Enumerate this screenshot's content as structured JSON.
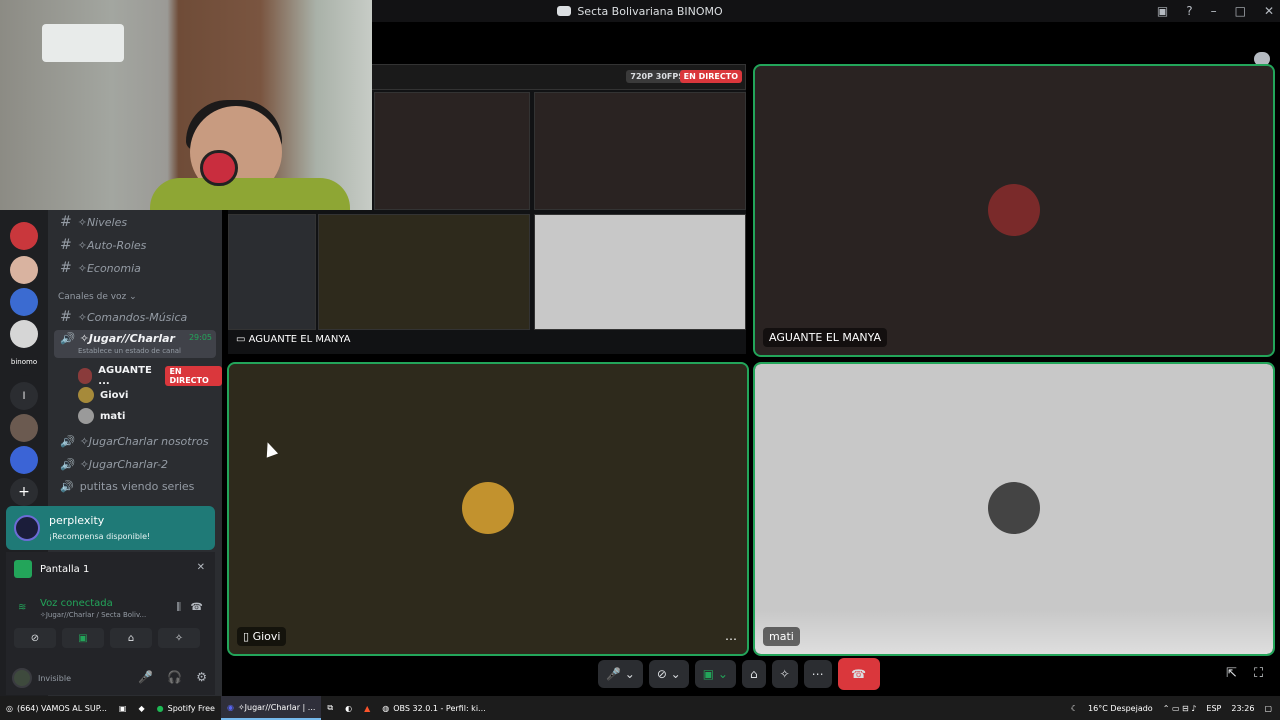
{
  "window": {
    "title": "Secta Bolivariana BINOMO"
  },
  "channels": {
    "text_items": [
      "✧Niveles",
      "✧Auto-Roles",
      "✧Economia"
    ],
    "voice_header": "Canales de voz",
    "voice_items": [
      {
        "label": "✧Comandos-Música"
      },
      {
        "label": "✧Jugar//Charlar",
        "timer": "29:05",
        "status_hint": "Establece un estado de canal"
      },
      {
        "label": "✧JugarCharlar nosotros"
      },
      {
        "label": "✧JugarCharlar-2"
      },
      {
        "label": "putitas viendo series"
      }
    ],
    "members": [
      {
        "name": "AGUANTE ...",
        "badge": "EN DIRECTO"
      },
      {
        "name": "Giovi"
      },
      {
        "name": "mati"
      }
    ]
  },
  "promo": {
    "title": "perplexity",
    "subtitle": "¡Recompensa disponible!"
  },
  "screen_panel": {
    "label": "Pantalla 1"
  },
  "voice_status": {
    "title": "Voz conectada",
    "subtitle": "✧Jugar//Charlar / Secta Boliv..."
  },
  "user": {
    "status": "Invisible"
  },
  "stage": {
    "share_name": "AGUANTE EL MANYA",
    "share_badges": {
      "quality": "720P 30FPS",
      "live": "EN DIRECTO"
    },
    "tiles": [
      {
        "name": "AGUANTE EL MANYA",
        "speaking": true
      },
      {
        "name": "Giovi",
        "speaking": true
      },
      {
        "name": "mati",
        "speaking": true
      }
    ]
  },
  "taskbar": {
    "items": [
      {
        "label": "(664) VAMOS AL SUP..."
      },
      {
        "label": "Spotify Free"
      },
      {
        "label": "✧Jugar//Charlar | ...",
        "active": true
      },
      {
        "label": "OBS 32.0.1 - Perfil: ki..."
      }
    ],
    "weather": "16°C Despejado",
    "lang": "ESP",
    "time": "23:26"
  },
  "colors": {
    "accent_green": "#23a55a",
    "live_red": "#da373c",
    "promo_teal": "#1f7a77"
  }
}
